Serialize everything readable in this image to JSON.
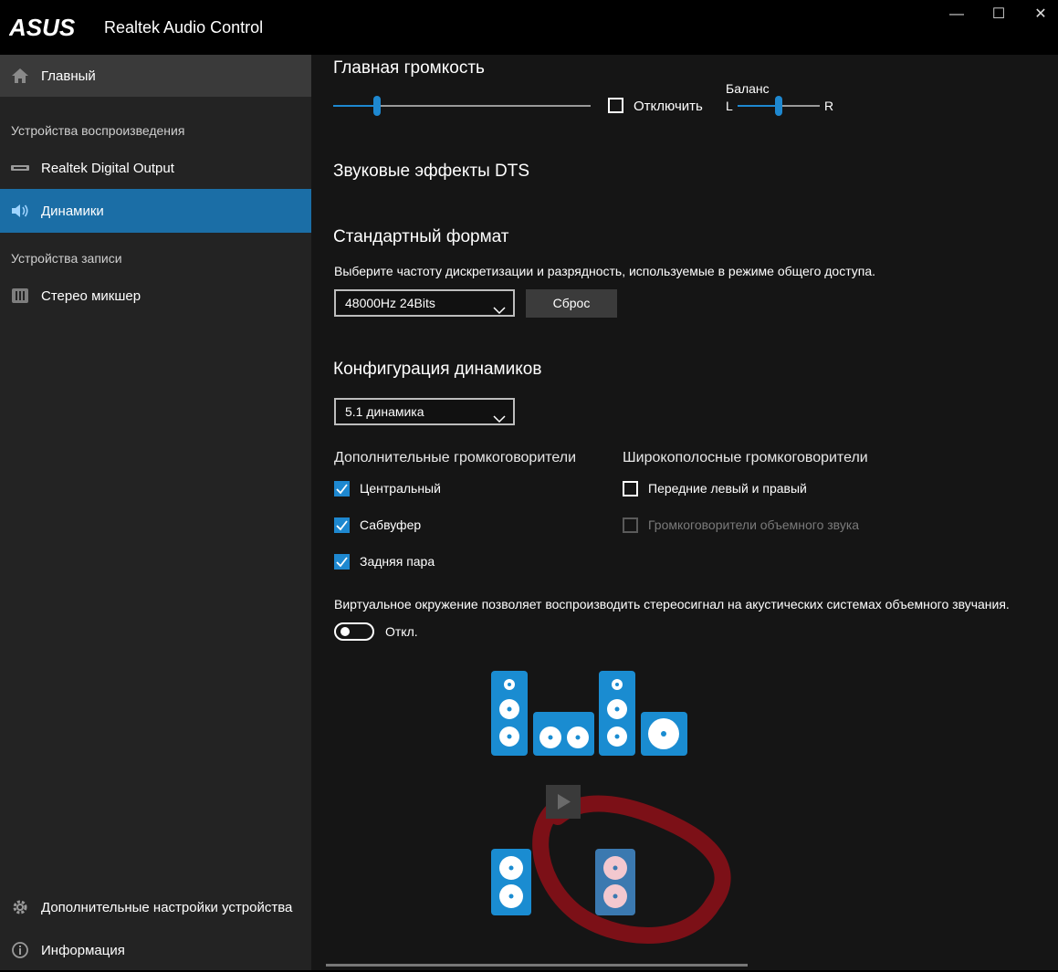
{
  "app": {
    "brand": "ASUS",
    "title": "Realtek Audio Control"
  },
  "window": {
    "minimize": "—",
    "maximize": "☐",
    "close": "✕"
  },
  "sidebar": {
    "home": "Главный",
    "playback_section": "Устройства воспроизведения",
    "playback_items": [
      "Realtek Digital Output",
      "Динамики"
    ],
    "recording_section": "Устройства записи",
    "recording_items": [
      "Стерео микшер"
    ],
    "advanced": "Дополнительные настройки устройства",
    "info": "Информация"
  },
  "main": {
    "volume": {
      "title": "Главная громкость",
      "level": 0.17,
      "mute_label": "Отключить",
      "muted": false
    },
    "balance": {
      "label": "Баланс",
      "left": "L",
      "right": "R",
      "level": 0.5
    },
    "dts_title": "Звуковые эффекты DTS",
    "format": {
      "title": "Стандартный формат",
      "description": "Выберите частоту дискретизации и разрядность, используемые в режиме общего доступа.",
      "selected": "48000Hz 24Bits",
      "reset": "Сброс"
    },
    "speakers": {
      "title": "Конфигурация динамиков",
      "selected": "5.1 динамика",
      "optional_title": "Дополнительные громкоговорители",
      "optional": [
        {
          "label": "Центральный",
          "checked": true
        },
        {
          "label": "Сабвуфер",
          "checked": true
        },
        {
          "label": "Задняя пара",
          "checked": true
        }
      ],
      "fullrange_title": "Широкополосные громкоговорители",
      "fullrange": [
        {
          "label": "Передние левый и правый",
          "checked": false,
          "disabled": false
        },
        {
          "label": "Громкоговорители объемного звука",
          "checked": false,
          "disabled": true
        }
      ],
      "virtual_description": "Виртуальное окружение позволяет воспроизводить стереосигнал на акустических системах объемного звучания.",
      "virtual_state": "Откл."
    }
  },
  "colors": {
    "accent": "#1e88d0",
    "active_nav": "#1b6ea6",
    "speaker": "#1a8cd1",
    "circle": "#b0121f"
  }
}
